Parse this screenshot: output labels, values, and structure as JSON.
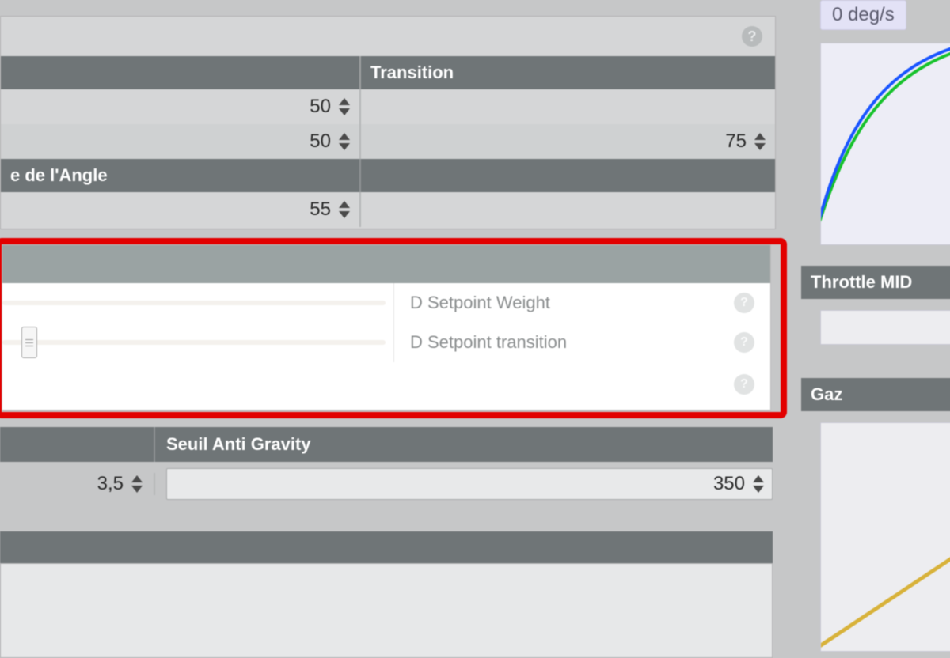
{
  "top_panel": {
    "help": "?",
    "header_left": "",
    "header_right": "Transition",
    "row1_left_value": "50",
    "row1_right_value": "",
    "row2_left_value": "50",
    "row2_right_value": "75",
    "sub_header_left": "e de l'Angle",
    "row3_left_value": "55"
  },
  "setpoint": {
    "row1_label": "D Setpoint Weight",
    "row2_label": "D Setpoint transition",
    "help": "?"
  },
  "antigravity": {
    "header_right": "Seuil Anti Gravity",
    "left_value": "3,5",
    "right_value": "350"
  },
  "right": {
    "badge": "0 deg/s",
    "throttle_mid": "Throttle MID",
    "gaz": "Gaz"
  },
  "chart_data": [
    {
      "type": "line",
      "title": "",
      "xlabel": "",
      "ylabel": "",
      "xlim": [
        0,
        100
      ],
      "ylim": [
        0,
        100
      ],
      "series": [
        {
          "name": "curve-blue",
          "color": "#1955ff",
          "x": [
            0,
            10,
            20,
            30,
            40,
            50,
            60,
            70,
            80,
            90,
            100
          ],
          "values": [
            0,
            30,
            48,
            60,
            69,
            76,
            82,
            87,
            91,
            94,
            97
          ]
        },
        {
          "name": "curve-green",
          "color": "#17c22c",
          "x": [
            0,
            10,
            20,
            30,
            40,
            50,
            60,
            70,
            80,
            90,
            100
          ],
          "values": [
            0,
            28,
            45,
            57,
            66,
            73,
            79,
            84,
            88,
            92,
            95
          ]
        }
      ]
    },
    {
      "type": "line",
      "title": "",
      "xlabel": "",
      "ylabel": "",
      "xlim": [
        0,
        100
      ],
      "ylim": [
        0,
        100
      ],
      "series": [
        {
          "name": "gaz-line",
          "color": "#d8b23a",
          "x": [
            0,
            100
          ],
          "values": [
            0,
            60
          ]
        }
      ]
    }
  ]
}
